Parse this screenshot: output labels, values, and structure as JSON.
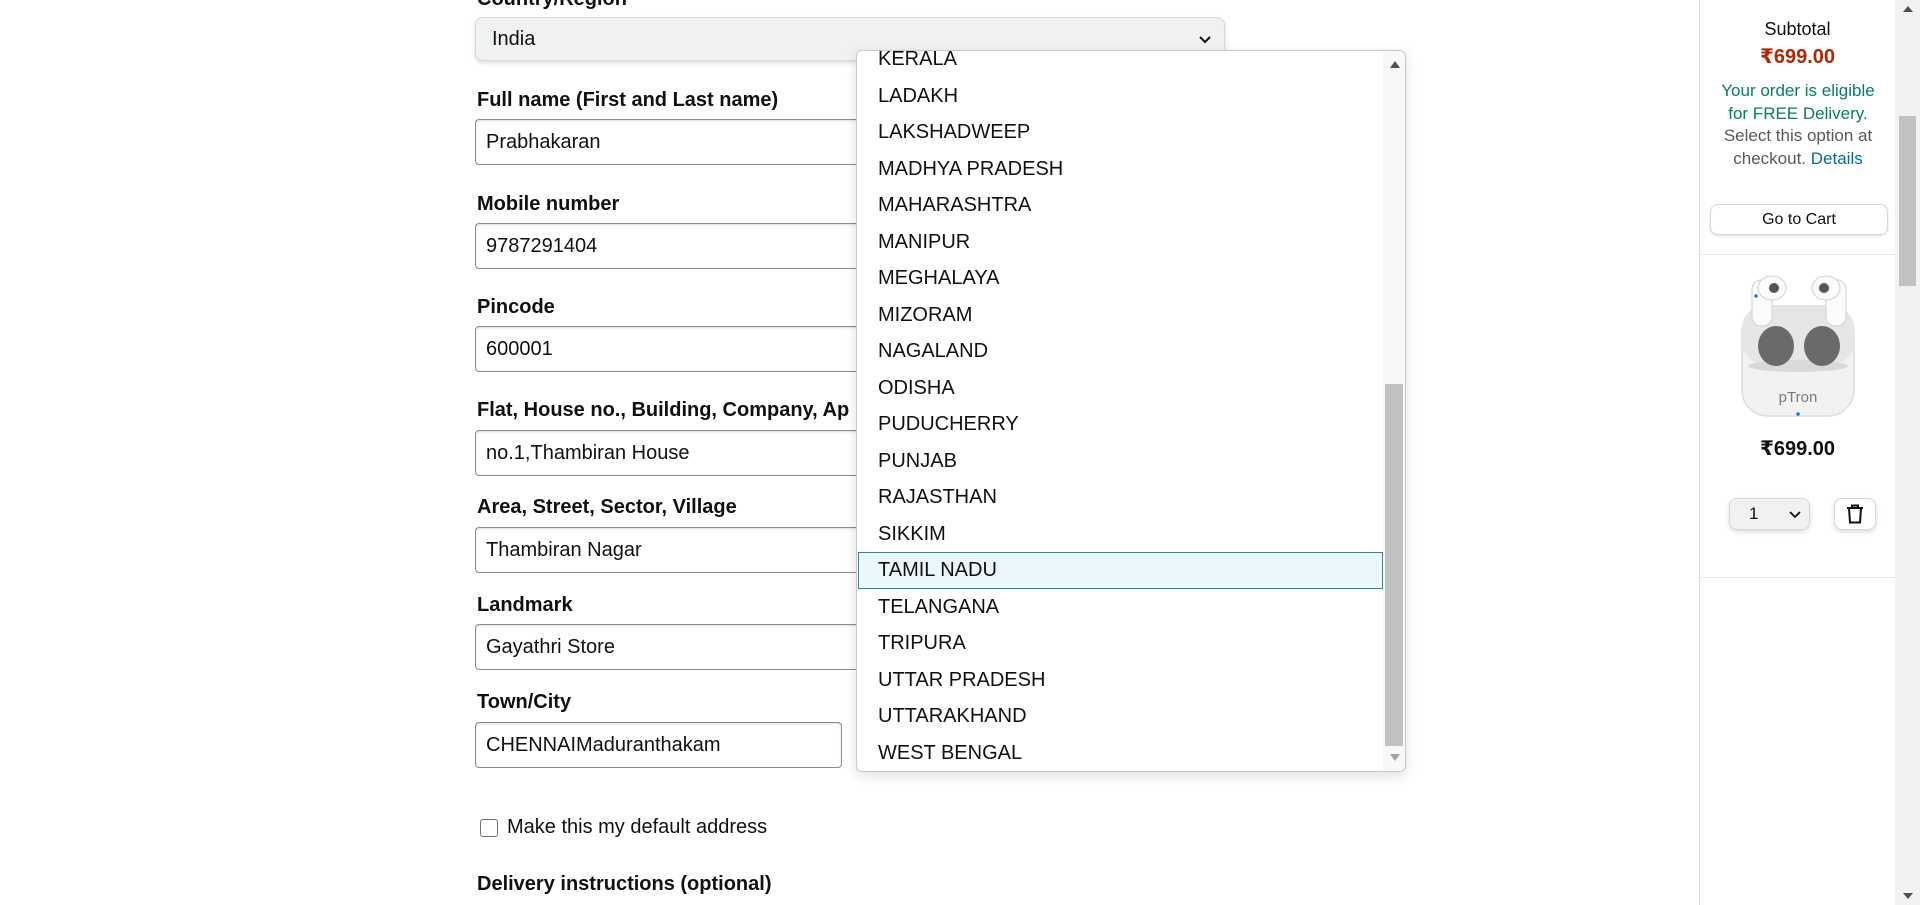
{
  "form": {
    "country_label": "Country/Region",
    "country_value": "India",
    "fullname_label": "Full name (First and Last name)",
    "fullname_value": "Prabhakaran",
    "mobile_label": "Mobile number",
    "mobile_value": "9787291404",
    "pincode_label": "Pincode",
    "pincode_value": "600001",
    "flat_label": "Flat, House no., Building, Company, Ap",
    "flat_value": "no.1,Thambiran House",
    "area_label": "Area, Street, Sector, Village",
    "area_value": "Thambiran Nagar",
    "landmark_label": "Landmark",
    "landmark_value": "Gayathri Store",
    "city_label": "Town/City",
    "city_value": "CHENNAIMaduranthakam",
    "default_address_label": "Make this my default address",
    "delivery_instructions_label": "Delivery instructions (optional)"
  },
  "state_dropdown": {
    "items": [
      "KERALA",
      "LADAKH",
      "LAKSHADWEEP",
      "MADHYA PRADESH",
      "MAHARASHTRA",
      "MANIPUR",
      "MEGHALAYA",
      "MIZORAM",
      "NAGALAND",
      "ODISHA",
      "PUDUCHERRY",
      "PUNJAB",
      "RAJASTHAN",
      "SIKKIM",
      "TAMIL NADU",
      "TELANGANA",
      "TRIPURA",
      "UTTAR PRADESH",
      "UTTARAKHAND",
      "WEST BENGAL"
    ],
    "selected": "TAMIL NADU"
  },
  "cart_sidebar": {
    "subtotal_label": "Subtotal",
    "subtotal_value": "₹699.00",
    "free_delivery_text": "Your order is eligible for FREE Delivery.",
    "select_option_text": "Select this option at checkout.",
    "details_link": "Details",
    "go_to_cart": "Go to Cart",
    "product_brand": "pTron",
    "product_price": "₹699.00",
    "quantity": "1"
  },
  "colors": {
    "price_red": "#b12704",
    "free_green": "#067d62",
    "link_teal": "#007185",
    "selected_outline": "#2b8a8a"
  }
}
